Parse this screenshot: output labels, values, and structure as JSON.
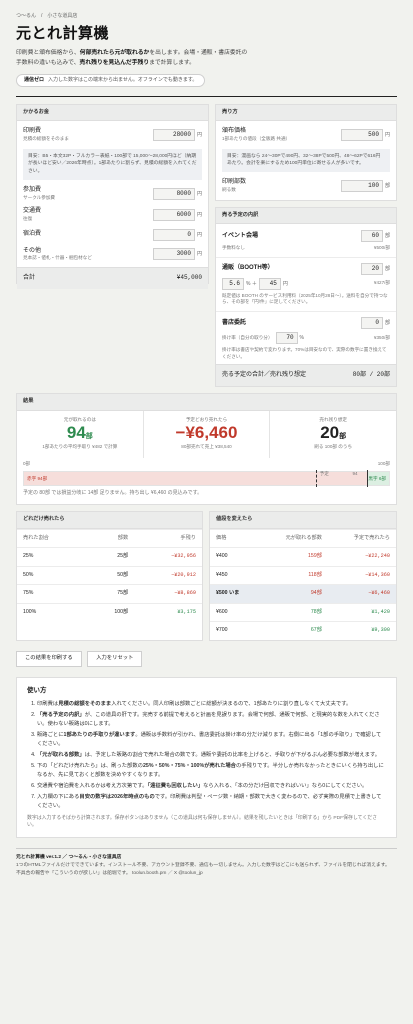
{
  "breadcrumb": "つ～るん　/　小さな道具店",
  "title": "元とれ計算機",
  "lead_pre": "印刷費と頒布価格から、",
  "lead_b1": "何部売れたら元が取れるか",
  "lead_mid": "を出します。会場・通販・書店委託の手数料の違いも込みで、",
  "lead_b2": "売れ残りを見込んだ手残り",
  "lead_post": "まで計算します。",
  "chip_b": "通信ゼロ",
  "chip_t": "入力した数字はこの端末から出ません。オフラインでも動きます。",
  "cost": {
    "header": "かかるお金",
    "print_label": "印刷費",
    "print_sub": "見積の総額をそのまま",
    "print_val": "28000",
    "yen": "円",
    "note": "目安：B5・本文32P・フルカラー表紙・100部で 15,000〜28,000円ほど（納期が長いほど安い／2026年時点）。1部あたりに割らず、見積の総額を入れてください。",
    "fee_label": "参加費",
    "fee_sub": "サークル参加費",
    "fee_val": "8000",
    "travel_label": "交通費",
    "travel_sub": "往復",
    "travel_val": "6000",
    "stay_label": "宿泊費",
    "stay_val": "0",
    "other_label": "その他",
    "other_sub": "見本誌・値札・什器・梱包材など",
    "other_val": "3000",
    "total_label": "合計",
    "total_val": "¥45,000"
  },
  "sale": {
    "header": "売り方",
    "price_label": "頒布価格",
    "price_sub": "1部あたりの値段（全販路 共通）",
    "price_val": "500",
    "note": "目安：漫画なら 24〜30Pで490円、32〜38Pで500円、48〜62Pで616円あたり。会計を楽にするため100円単位に寄せる人が多いです。",
    "qty_label": "印刷部数",
    "qty_sub": "刷る数",
    "qty_val": "100",
    "bu": "部"
  },
  "plan": {
    "header": "売る予定の内訳",
    "event_label": "イベント会場",
    "event_val": "60",
    "event_fee": "手数料なし",
    "event_net": "¥500/部",
    "booth_label": "通販（BOOTH等）",
    "booth_val": "20",
    "booth_pct": "5.6",
    "booth_plus": "45",
    "booth_net": "¥427/部",
    "booth_note": "既定値は BOOTH のサービス利用料（2025年10月28日〜）。送料を自分で持つなら、その部を「円/件」に足してください。",
    "shop_label": "書店委託",
    "shop_val": "0",
    "shop_rate_label": "掛け率（自分の取り分）",
    "shop_rate": "70",
    "shop_net": "¥350/部",
    "shop_note": "掛け率は書店や契約で変わります。70%は目安なので、実際の数字に置き換えてください。",
    "footer_label": "売る予定の合計／売れ残り想定",
    "footer_val": "80部 / 20部"
  },
  "result": {
    "header": "結果",
    "c1_label": "元が取れるのは",
    "c1_val": "94",
    "c1_unit": "部",
    "c1_sub": "1部あたりの平均手取り ¥482 で計算",
    "c2_label": "予定どおり売れたら",
    "c2_val": "−¥6,460",
    "c2_sub": "80部売れて売上 ¥38,540",
    "c3_label": "売れ残り想定",
    "c3_val": "20",
    "c3_unit": "部",
    "c3_sub": "刷る 100部 のうち",
    "bar_start": "0部",
    "bar_end": "100部",
    "bar_deficit": "赤字 94部",
    "bar_plan": "予定",
    "bar_breakeven": "94",
    "bar_surplus": "黒字 6部",
    "summary": "予定の 80部 では損益分岐に 14部 足りません。持ち出し ¥6,460 の見込みです。"
  },
  "sell_table": {
    "header": "どれだけ売れたら",
    "cols": [
      "売れた割合",
      "部数",
      "手残り"
    ],
    "rows": [
      [
        "25%",
        "25部",
        "−¥32,956"
      ],
      [
        "50%",
        "50部",
        "−¥20,912"
      ],
      [
        "75%",
        "75部",
        "−¥8,869"
      ],
      [
        "100%",
        "100部",
        "¥3,175"
      ]
    ]
  },
  "price_table": {
    "header": "値段を変えたら",
    "cols": [
      "価格",
      "元が取れる部数",
      "予定で売れたら"
    ],
    "rows": [
      [
        "¥400",
        "159部",
        "−¥22,240"
      ],
      [
        "¥450",
        "118部",
        "−¥14,360"
      ],
      [
        "¥500 いま",
        "94部",
        "−¥6,460"
      ],
      [
        "¥600",
        "78部",
        "¥1,420"
      ],
      [
        "¥700",
        "67部",
        "¥9,300"
      ]
    ]
  },
  "buttons": {
    "print": "この結果を印刷する",
    "reset": "入力をリセット"
  },
  "usage": {
    "title": "使い方",
    "items": [
      "印刷費は見積の総額をそのまま入れてください。同人印刷は部数ごとに総額が決まるので、1部あたりに割り直しなくて大丈夫です。",
      "「売る予定の内訳」が、この道具の肝です。完売する前提で考えると計画を見誤ります。会場で何部、通販で何部、と現実的な数を入れてください。使わない販路は0にします。",
      "販路ごとに1部あたりの手取りが違います。通販は手数料が引かれ、書店委託は掛け率の分だけ減ります。右側に出る「1部の手取り」で確認してください。",
      "「元が取れる部数」は、予定した販路の割合で売れた場合の数です。通販や委託の比率を上げると、手取りが下がるぶん必要な部数が増えます。",
      "下の「どれだけ売れたら」は、刷った部数の25%・50%・75%・100%が売れた場合の手残りです。半分しか売れなかったときにいくら持ち出しになるか、先に見ておくと部数を決めやすくなります。",
      "交通費や宿泊費を入れるかは考え方次第です。「遠征費も回収したい」なら入れる、「本の分だけ回収できればいい」なら0にしてください。",
      "入力欄の下にある目安の数字は2026年時点のものです。印刷費は判型・ページ数・納期・部数で大きく変わるので、必ず実際の見積で上書きしてください。"
    ],
    "bold": [
      "見積の総額をそのまま",
      "「売る予定の内訳」",
      "1部あたりの手取りが違います",
      "「元が取れる部数」",
      "25%・50%・75%・100%が売れた場合",
      "「遠征費も回収したい」",
      "目安の数字は2026年時点のもの"
    ],
    "closing": "数字は入力するそばから計算されます。保存ボタンはありません（この道具は何も保存しません）。結果を残したいときは「印刷する」から PDF保存してください。"
  },
  "footer": {
    "line1": "元とれ計算機 ver.1.2 ／ つ～るん・小さな道具店",
    "line2": "1つのHTMLファイルだけでできています。インストール不要、アカウント登録不要、通信も一切しません。入力した数字はどこにも送られず、ファイルを閉じれば消えます。",
    "line3": "不具合の報告や「こういうのが欲しい」は船堀です。 toolun.booth.pm ／ X @toolun_jp"
  },
  "colors": {
    "negative": "#c0392b",
    "positive": "#2e8b4f",
    "bar_deficit": "#f6dedb",
    "bar_surplus": "#dcefe2"
  }
}
